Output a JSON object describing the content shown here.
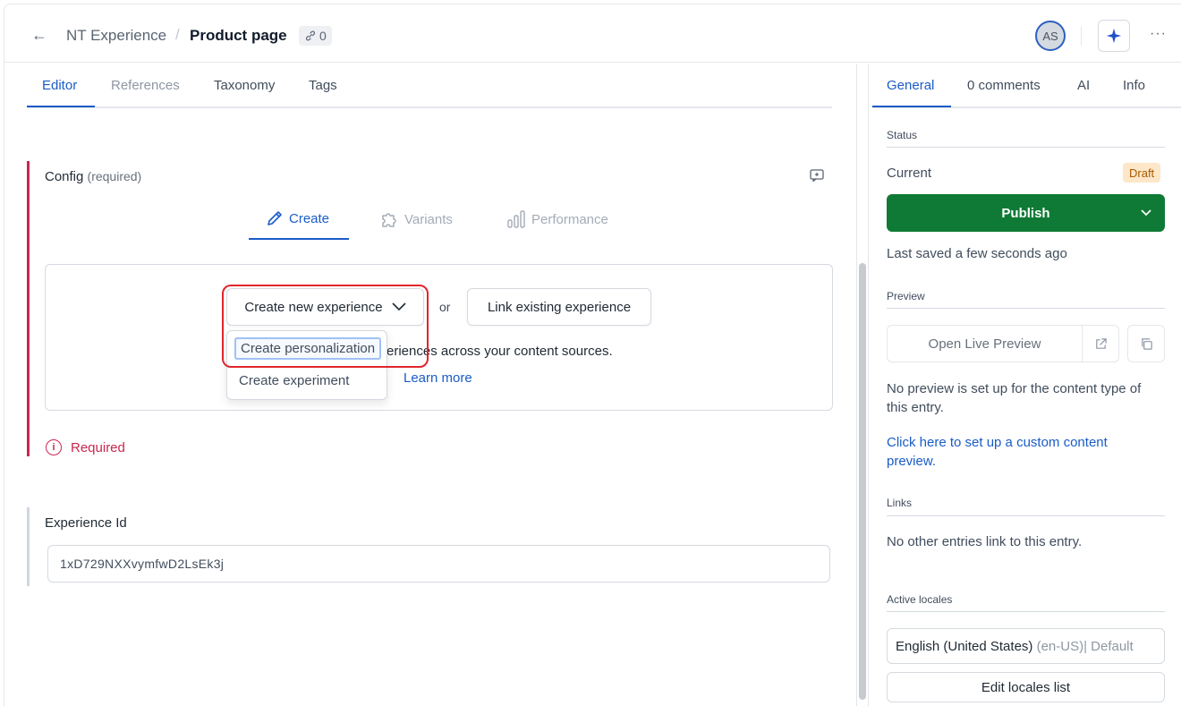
{
  "header": {
    "back_icon": "arrow-left-icon",
    "breadcrumb_parent": "NT Experience",
    "breadcrumb_separator": "/",
    "title": "Product page",
    "references_count": "0",
    "avatar_initials": "AS",
    "more_icon": "···"
  },
  "editor_tabs": [
    {
      "label": "Editor",
      "state": "active"
    },
    {
      "label": "References",
      "state": "muted"
    },
    {
      "label": "Taxonomy",
      "state": "normal"
    },
    {
      "label": "Tags",
      "state": "normal"
    }
  ],
  "config": {
    "label": "Config",
    "required_hint": "(required)",
    "subtabs": [
      {
        "label": "Create",
        "icon": "pencil-icon",
        "state": "active"
      },
      {
        "label": "Variants",
        "icon": "puzzle-icon",
        "state": "disabled"
      },
      {
        "label": "Performance",
        "icon": "bar-chart-icon",
        "state": "disabled"
      }
    ],
    "create_button": "Create new experience",
    "or_text": "or",
    "link_button": "Link existing experience",
    "description_visible": "eriences across your content sources.",
    "learn_more": "Learn more",
    "dropdown_items": [
      "Create personalization",
      "Create experiment"
    ],
    "required_message": "Required",
    "accent_color": "#c9274e"
  },
  "experience_id": {
    "label": "Experience Id",
    "value": "1xD729NXXvymfwD2LsEk3j"
  },
  "sidebar": {
    "tabs": [
      {
        "label": "General",
        "state": "active"
      },
      {
        "label": "0 comments",
        "state": "normal"
      },
      {
        "label": "AI",
        "state": "normal"
      },
      {
        "label": "Info",
        "state": "normal"
      }
    ],
    "status_title": "Status",
    "current_label": "Current",
    "status_badge": "Draft",
    "publish_label": "Publish",
    "publish_color": "#0f7a35",
    "last_saved": "Last saved a few seconds ago",
    "preview_title": "Preview",
    "open_preview": "Open Live Preview",
    "no_preview_text": "No preview is set up for the content type of this entry.",
    "setup_link": "Click here to set up a custom content preview.",
    "links_title": "Links",
    "no_links_text": "No other entries link to this entry.",
    "locales_title": "Active locales",
    "locale_name": "English (United States)",
    "locale_code": "(en-US)| Default",
    "edit_locales": "Edit locales list"
  }
}
